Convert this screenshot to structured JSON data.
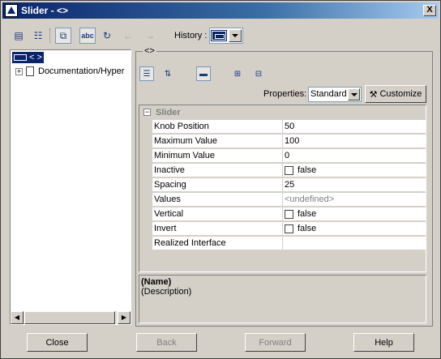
{
  "window": {
    "title": "Slider - <>",
    "close_glyph": "X"
  },
  "toolbar": {
    "history_label": "History :",
    "icons": [
      "properties-icon",
      "tree-icon",
      "copy-icon",
      "spelling-icon",
      "refresh-icon",
      "back-arrow-icon",
      "forward-arrow-icon"
    ]
  },
  "tree": {
    "root_label": "< >",
    "child_label": "Documentation/Hyper"
  },
  "panel": {
    "title": "<>",
    "properties_label": "Properties:",
    "properties_value": "Standard",
    "customize_label": "Customize"
  },
  "grid": {
    "group": "Slider",
    "rows": [
      {
        "name": "Knob Position",
        "value": "50",
        "type": "text"
      },
      {
        "name": "Maximum Value",
        "value": "100",
        "type": "text"
      },
      {
        "name": "Minimum Value",
        "value": "0",
        "type": "text"
      },
      {
        "name": "Inactive",
        "value": "false",
        "type": "check"
      },
      {
        "name": "Spacing",
        "value": "25",
        "type": "text"
      },
      {
        "name": "Values",
        "value": "<undefined>",
        "type": "undef"
      },
      {
        "name": "Vertical",
        "value": "false",
        "type": "check"
      },
      {
        "name": "Invert",
        "value": "false",
        "type": "check"
      },
      {
        "name": "Realized Interface",
        "value": "",
        "type": "text"
      }
    ]
  },
  "description": {
    "name": "(Name)",
    "text": "(Description)"
  },
  "buttons": {
    "close": "Close",
    "back": "Back",
    "forward": "Forward",
    "help": "Help"
  }
}
